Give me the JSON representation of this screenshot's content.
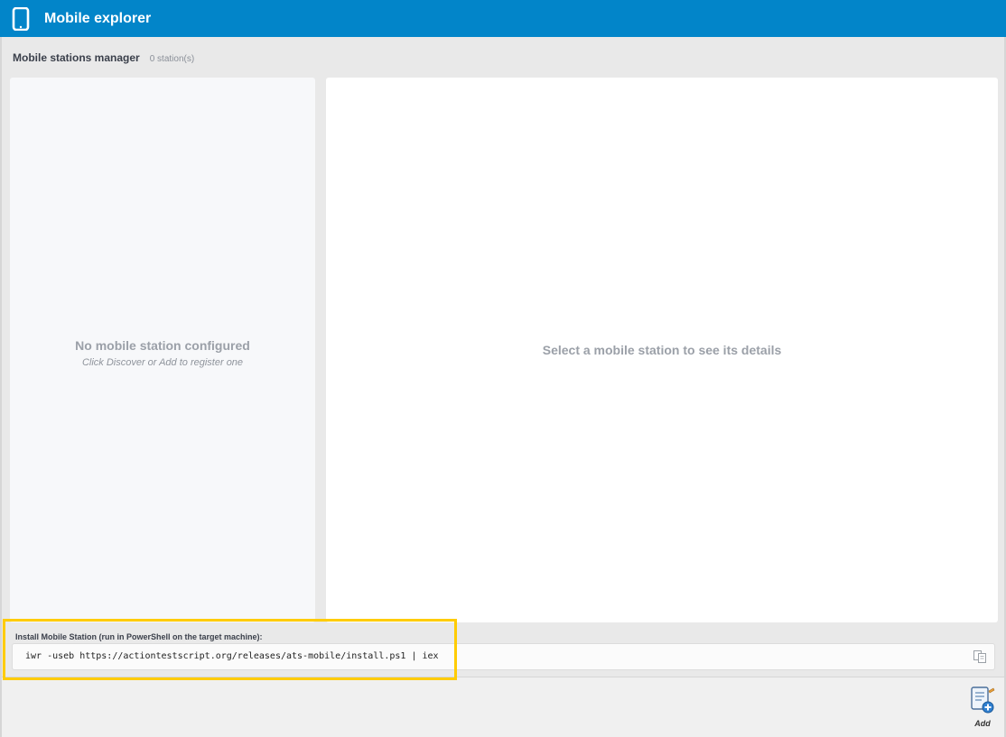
{
  "window": {
    "title": "Mobile explorer",
    "icon": "phone-icon",
    "accent_color": "#0285c9"
  },
  "manager": {
    "title": "Mobile stations manager",
    "count": "0 station(s)"
  },
  "left_panel": {
    "empty_title": "No mobile station configured",
    "empty_subtitle": "Click Discover or Add to register one"
  },
  "right_panel": {
    "hint": "Select a mobile station to see its details"
  },
  "install": {
    "label": "Install Mobile Station (run in PowerShell on the target machine):",
    "command": "iwr -useb https://actiontestscript.org/releases/ats-mobile/install.ps1 | iex",
    "copy_icon": "copy-icon",
    "highlight_color": "#ffcc00"
  },
  "toolbar": {
    "add_label": "Add",
    "add_icon": "add-station-icon"
  }
}
